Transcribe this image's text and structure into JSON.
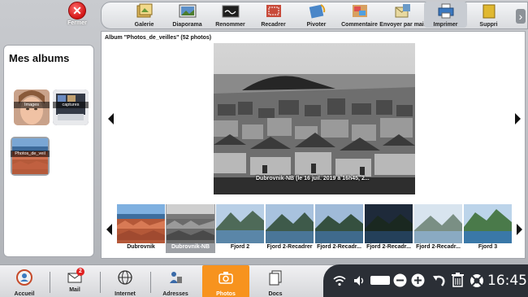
{
  "close": {
    "label": "Fermer"
  },
  "toolbar": {
    "items": [
      {
        "label": "Galerie",
        "icon": "gallery-icon"
      },
      {
        "label": "Diaporama",
        "icon": "slideshow-icon"
      },
      {
        "label": "Renommer",
        "icon": "rename-icon"
      },
      {
        "label": "Recadrer",
        "icon": "crop-icon"
      },
      {
        "label": "Pivoter",
        "icon": "rotate-icon"
      },
      {
        "label": "Commentaire",
        "icon": "comment-icon"
      },
      {
        "label": "Envoyer par mail",
        "icon": "send-mail-icon"
      },
      {
        "label": "Imprimer",
        "icon": "print-icon"
      },
      {
        "label": "Suppri",
        "icon": "delete-icon"
      }
    ]
  },
  "albums": {
    "title": "Mes albums",
    "items": [
      {
        "label": "Images"
      },
      {
        "label": "captures"
      },
      {
        "label": "Photos_de_veil"
      }
    ]
  },
  "main": {
    "title": "Album \"Photos_de_veilles\" (52 photos)",
    "caption": "Dubrovnik-NB (le 16 juil. 2019 à 16h45, 2..."
  },
  "filmstrip": [
    {
      "label": "Dubrovnik"
    },
    {
      "label": "Dubrovnik-NB"
    },
    {
      "label": "Fjord 2"
    },
    {
      "label": "Fjord 2-Recadrer"
    },
    {
      "label": "Fjord 2-Recadr..."
    },
    {
      "label": "Fjord 2-Recadr..."
    },
    {
      "label": "Fjord 2-Recadr..."
    },
    {
      "label": "Fjord 3"
    }
  ],
  "nav": {
    "items": [
      {
        "label": "Accueil"
      },
      {
        "label": "Mail",
        "badge": "2"
      },
      {
        "label": "Internet"
      },
      {
        "label": "Adresses"
      },
      {
        "label": "Photos"
      },
      {
        "label": "Docs"
      }
    ]
  },
  "system": {
    "time": "16:45"
  },
  "colors": {
    "accent": "#f7931e",
    "close": "#d21414",
    "sysbar": "#2b2f36"
  }
}
